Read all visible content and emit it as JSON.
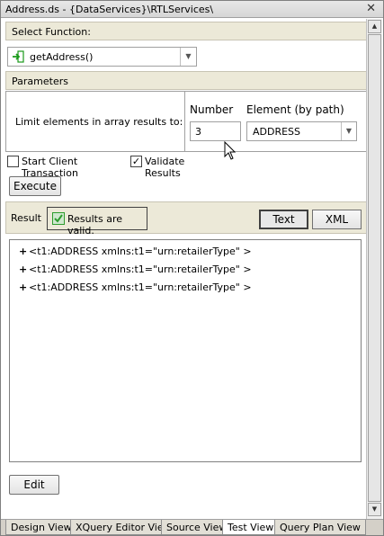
{
  "window": {
    "title": "Address.ds - {DataServices}\\RTLServices\\"
  },
  "select_function": {
    "header": "Select Function:",
    "value": "getAddress()"
  },
  "parameters": {
    "header": "Parameters",
    "limit_label": "Limit elements in array results to:",
    "number_header": "Number",
    "element_header": "Element (by path)",
    "number_value": "3",
    "element_value": "ADDRESS"
  },
  "options": {
    "start_client_transaction": {
      "label": "Start Client Transaction",
      "checked": false
    },
    "validate_results": {
      "label": "Validate Results",
      "checked": true
    }
  },
  "execute_label": "Execute",
  "result": {
    "label": "Result",
    "status": "Results are valid.",
    "text_button": "Text",
    "xml_button": "XML",
    "active_view": "Text"
  },
  "tree": {
    "items": [
      {
        "expander": "+",
        "text": "<t1:ADDRESS xmlns:t1=\"urn:retailerType\" >"
      },
      {
        "expander": "+",
        "text": "<t1:ADDRESS xmlns:t1=\"urn:retailerType\" >"
      },
      {
        "expander": "+",
        "text": "<t1:ADDRESS xmlns:t1=\"urn:retailerType\" >"
      }
    ]
  },
  "edit_label": "Edit",
  "tabs": [
    {
      "label": "Design View",
      "active": false
    },
    {
      "label": "XQuery Editor View",
      "active": false
    },
    {
      "label": "Source View",
      "active": false
    },
    {
      "label": "Test View",
      "active": true
    },
    {
      "label": "Query Plan View",
      "active": false
    }
  ],
  "icons": {
    "close": "close-icon",
    "function": "function-arrow-icon",
    "valid": "checkmark-icon"
  },
  "colors": {
    "header_bg": "#ece9d8",
    "valid_check": "#2e9c2e",
    "function_icon": "#1a9a1a"
  }
}
